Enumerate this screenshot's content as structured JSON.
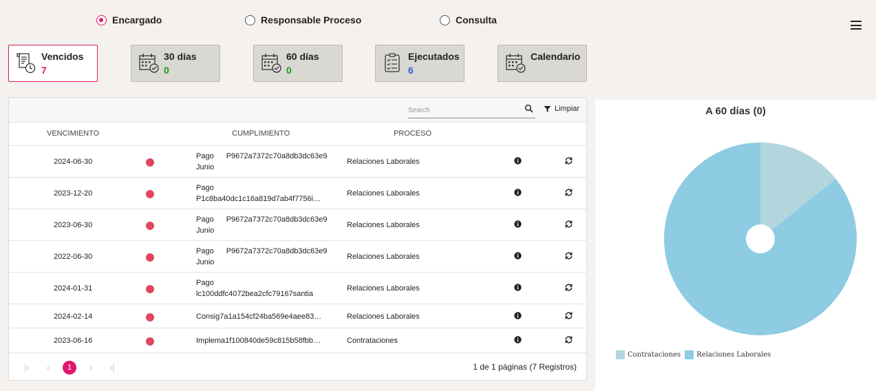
{
  "filters": {
    "options": [
      {
        "label": "Encargado",
        "selected": true
      },
      {
        "label": "Responsable Proceso",
        "selected": false
      },
      {
        "label": "Consulta",
        "selected": false
      }
    ]
  },
  "cards": [
    {
      "title": "Vencidos",
      "count": "7",
      "count_color": "#d21a62",
      "icon": "overdue-document-clock-icon",
      "active": true
    },
    {
      "title": "30 días",
      "count": "0",
      "count_color": "#1e9a1e",
      "icon": "calendar-check-icon",
      "active": false
    },
    {
      "title": "60 días",
      "count": "0",
      "count_color": "#1e9a1e",
      "icon": "calendar-check-icon",
      "active": false
    },
    {
      "title": "Ejecutados",
      "count": "6",
      "count_color": "#2f5fd6",
      "icon": "clipboard-checklist-icon",
      "active": false
    },
    {
      "title": "Calendario",
      "count": "",
      "count_color": "#222222",
      "icon": "calendar-check-icon",
      "active": false
    }
  ],
  "toolbar": {
    "search_placeholder": "Search",
    "clear_label": "Limpiar"
  },
  "table": {
    "headers": {
      "vencimiento": "VENCIMIENTO",
      "cumplimiento": "CUMPLIMIENTO",
      "proceso": "PROCESO"
    },
    "rows": [
      {
        "vencimiento": "2024-06-30",
        "cump_a": "Pago",
        "cump_code": "P9672a7372c70a8db3dc63e9",
        "cump_b": "Junio",
        "layout": "split",
        "proceso": "Relaciones Laborales"
      },
      {
        "vencimiento": "2023-12-20",
        "cump_a": "Pago",
        "cump_code": "",
        "cump_b": "P1c8ba40dc1c16a819d7ab4f7756iem...",
        "layout": "stack",
        "proceso": "Relaciones Laborales"
      },
      {
        "vencimiento": "2023-06-30",
        "cump_a": "Pago",
        "cump_code": "P9672a7372c70a8db3dc63e9",
        "cump_b": "Junio",
        "layout": "split",
        "proceso": "Relaciones Laborales"
      },
      {
        "vencimiento": "2022-06-30",
        "cump_a": "Pago",
        "cump_code": "P9672a7372c70a8db3dc63e9",
        "cump_b": "Junio",
        "layout": "split",
        "proceso": "Relaciones Laborales"
      },
      {
        "vencimiento": "2024-01-31",
        "cump_a": "Pago",
        "cump_code": "",
        "cump_b": "lc100ddfc4072bea2cfc79167santia",
        "layout": "stack",
        "proceso": "Relaciones Laborales"
      },
      {
        "vencimiento": "2024-02-14",
        "cump_a": "Consig7a1a154cf24ba569e4aee837a...",
        "cump_code": "",
        "cump_b": "",
        "layout": "single",
        "proceso": "Relaciones Laborales"
      },
      {
        "vencimiento": "2023-06-16",
        "cump_a": "Implema1f100840de59c815b58fbb89...",
        "cump_code": "",
        "cump_b": "",
        "layout": "single",
        "proceso": "Contrataciones"
      }
    ],
    "status_color": "#e0475f"
  },
  "pagination": {
    "current_page": "1",
    "summary": "1 de 1 páginas (7 Registros)"
  },
  "chart_data": {
    "type": "pie",
    "title": "A 60 días (0)",
    "series": [
      {
        "name": "Contrataciones",
        "value": 1,
        "color": "#b3d5dd"
      },
      {
        "name": "Relaciones Laborales",
        "value": 6,
        "color": "#8dcce3"
      }
    ],
    "legend_position": "bottom-left"
  }
}
